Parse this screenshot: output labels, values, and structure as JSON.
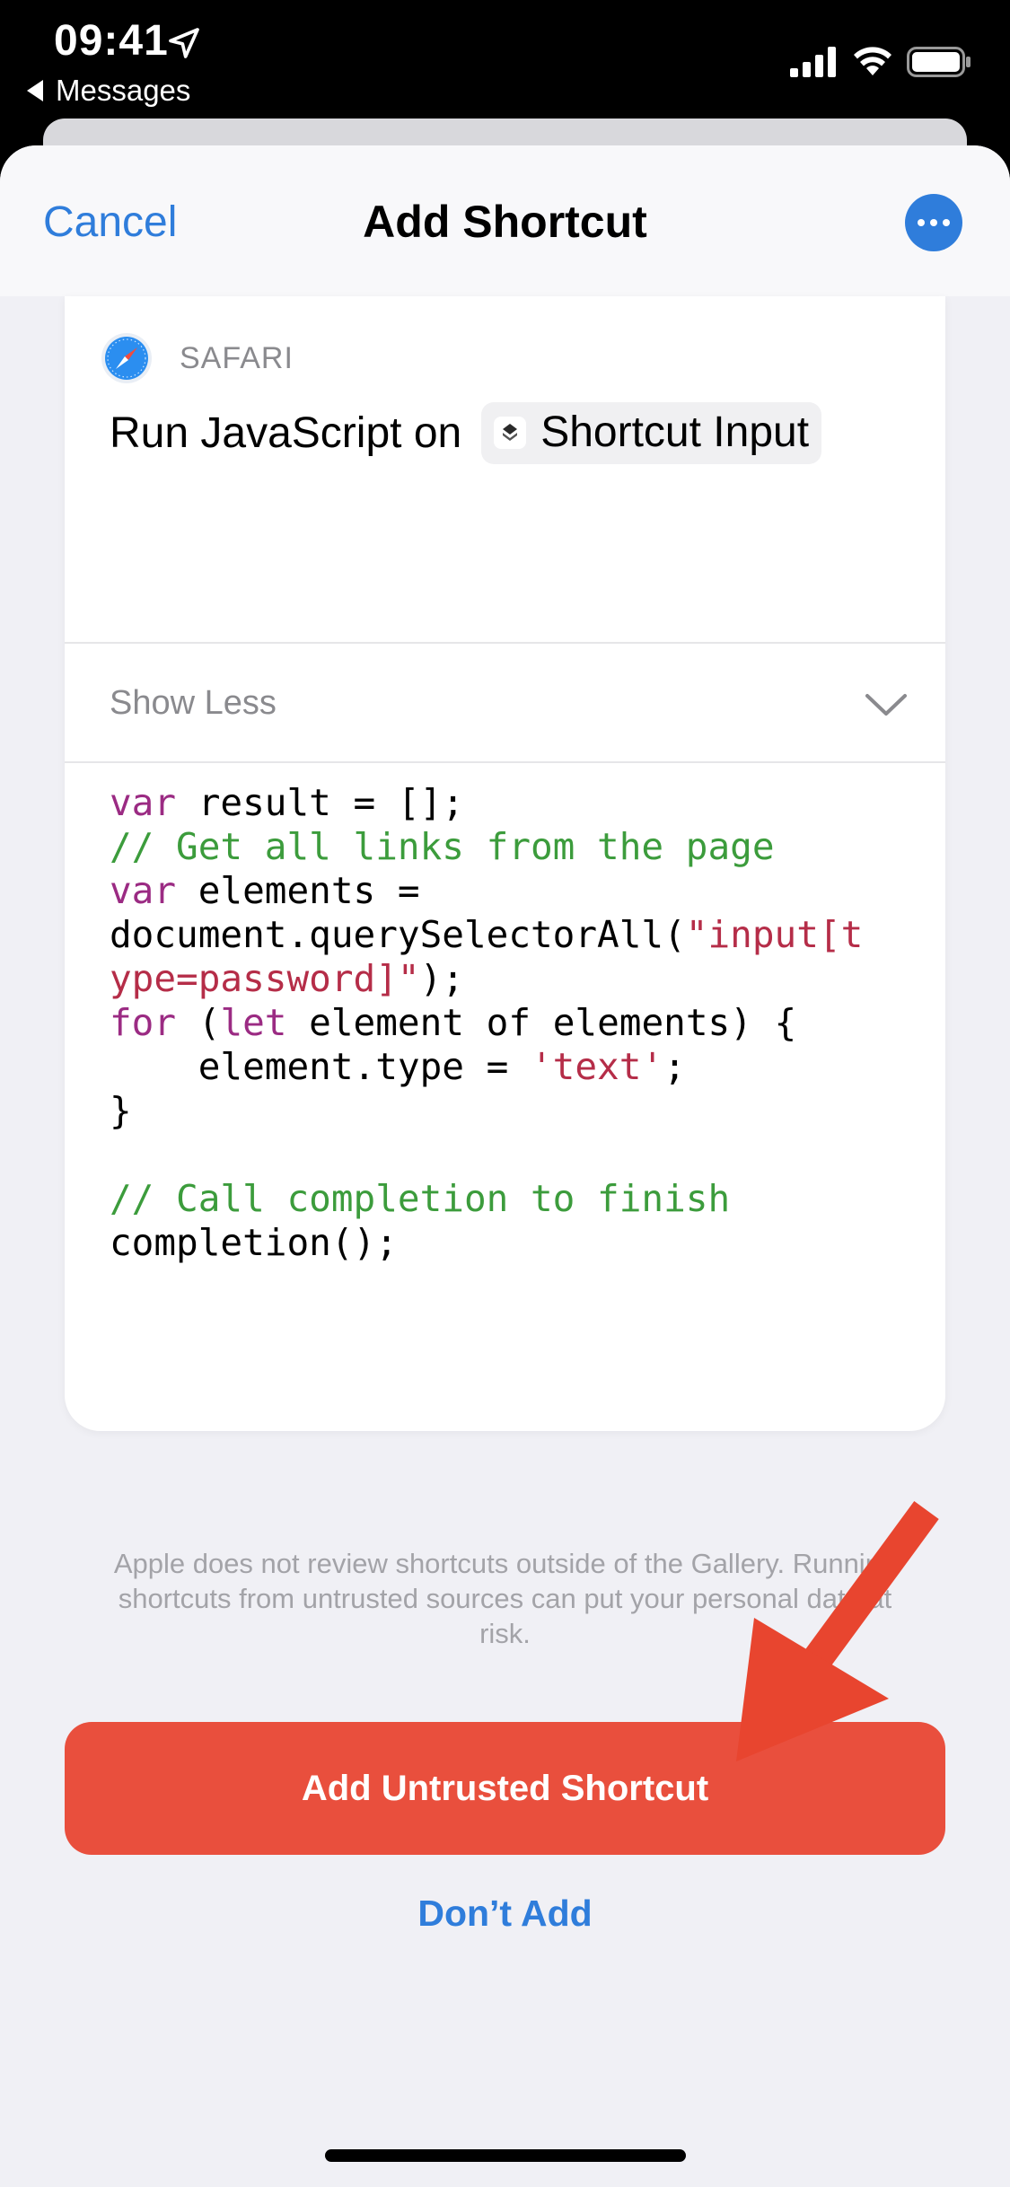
{
  "status_bar": {
    "time": "09:41",
    "back_app": "Messages"
  },
  "nav": {
    "cancel_label": "Cancel",
    "title": "Add Shortcut"
  },
  "action": {
    "app_name": "SAFARI",
    "description": "Run JavaScript on",
    "input_label": "Shortcut Input",
    "toggle_label": "Show Less"
  },
  "code": {
    "l1_kw": "var",
    "l1_rest": " result = [];",
    "l2_comment": "// Get all links from the page",
    "l3_kw": "var",
    "l3_rest": " elements =",
    "l4_plain": "document.querySelectorAll(",
    "l4_str": "\"input[t",
    "l5_str": "ype=password]\"",
    "l5_rest": ");",
    "l6_kw1": "for",
    "l6_mid1": " (",
    "l6_kw2": "let",
    "l6_rest": " element of elements) {",
    "l7_plain": "    element.type = ",
    "l7_str": "'text'",
    "l7_rest": ";",
    "l8": "}",
    "l10_comment": "// Call completion to finish",
    "l11": "completion();"
  },
  "footer": {
    "disclaimer": "Apple does not review shortcuts outside of the Gallery. Running shortcuts from untrusted sources can put your personal data at risk.",
    "add_label": "Add Untrusted Shortcut",
    "dont_add_label": "Don’t Add"
  },
  "colors": {
    "accent": "#2f7ddb",
    "danger": "#e94f3d",
    "annotation_arrow": "#e8452f"
  }
}
